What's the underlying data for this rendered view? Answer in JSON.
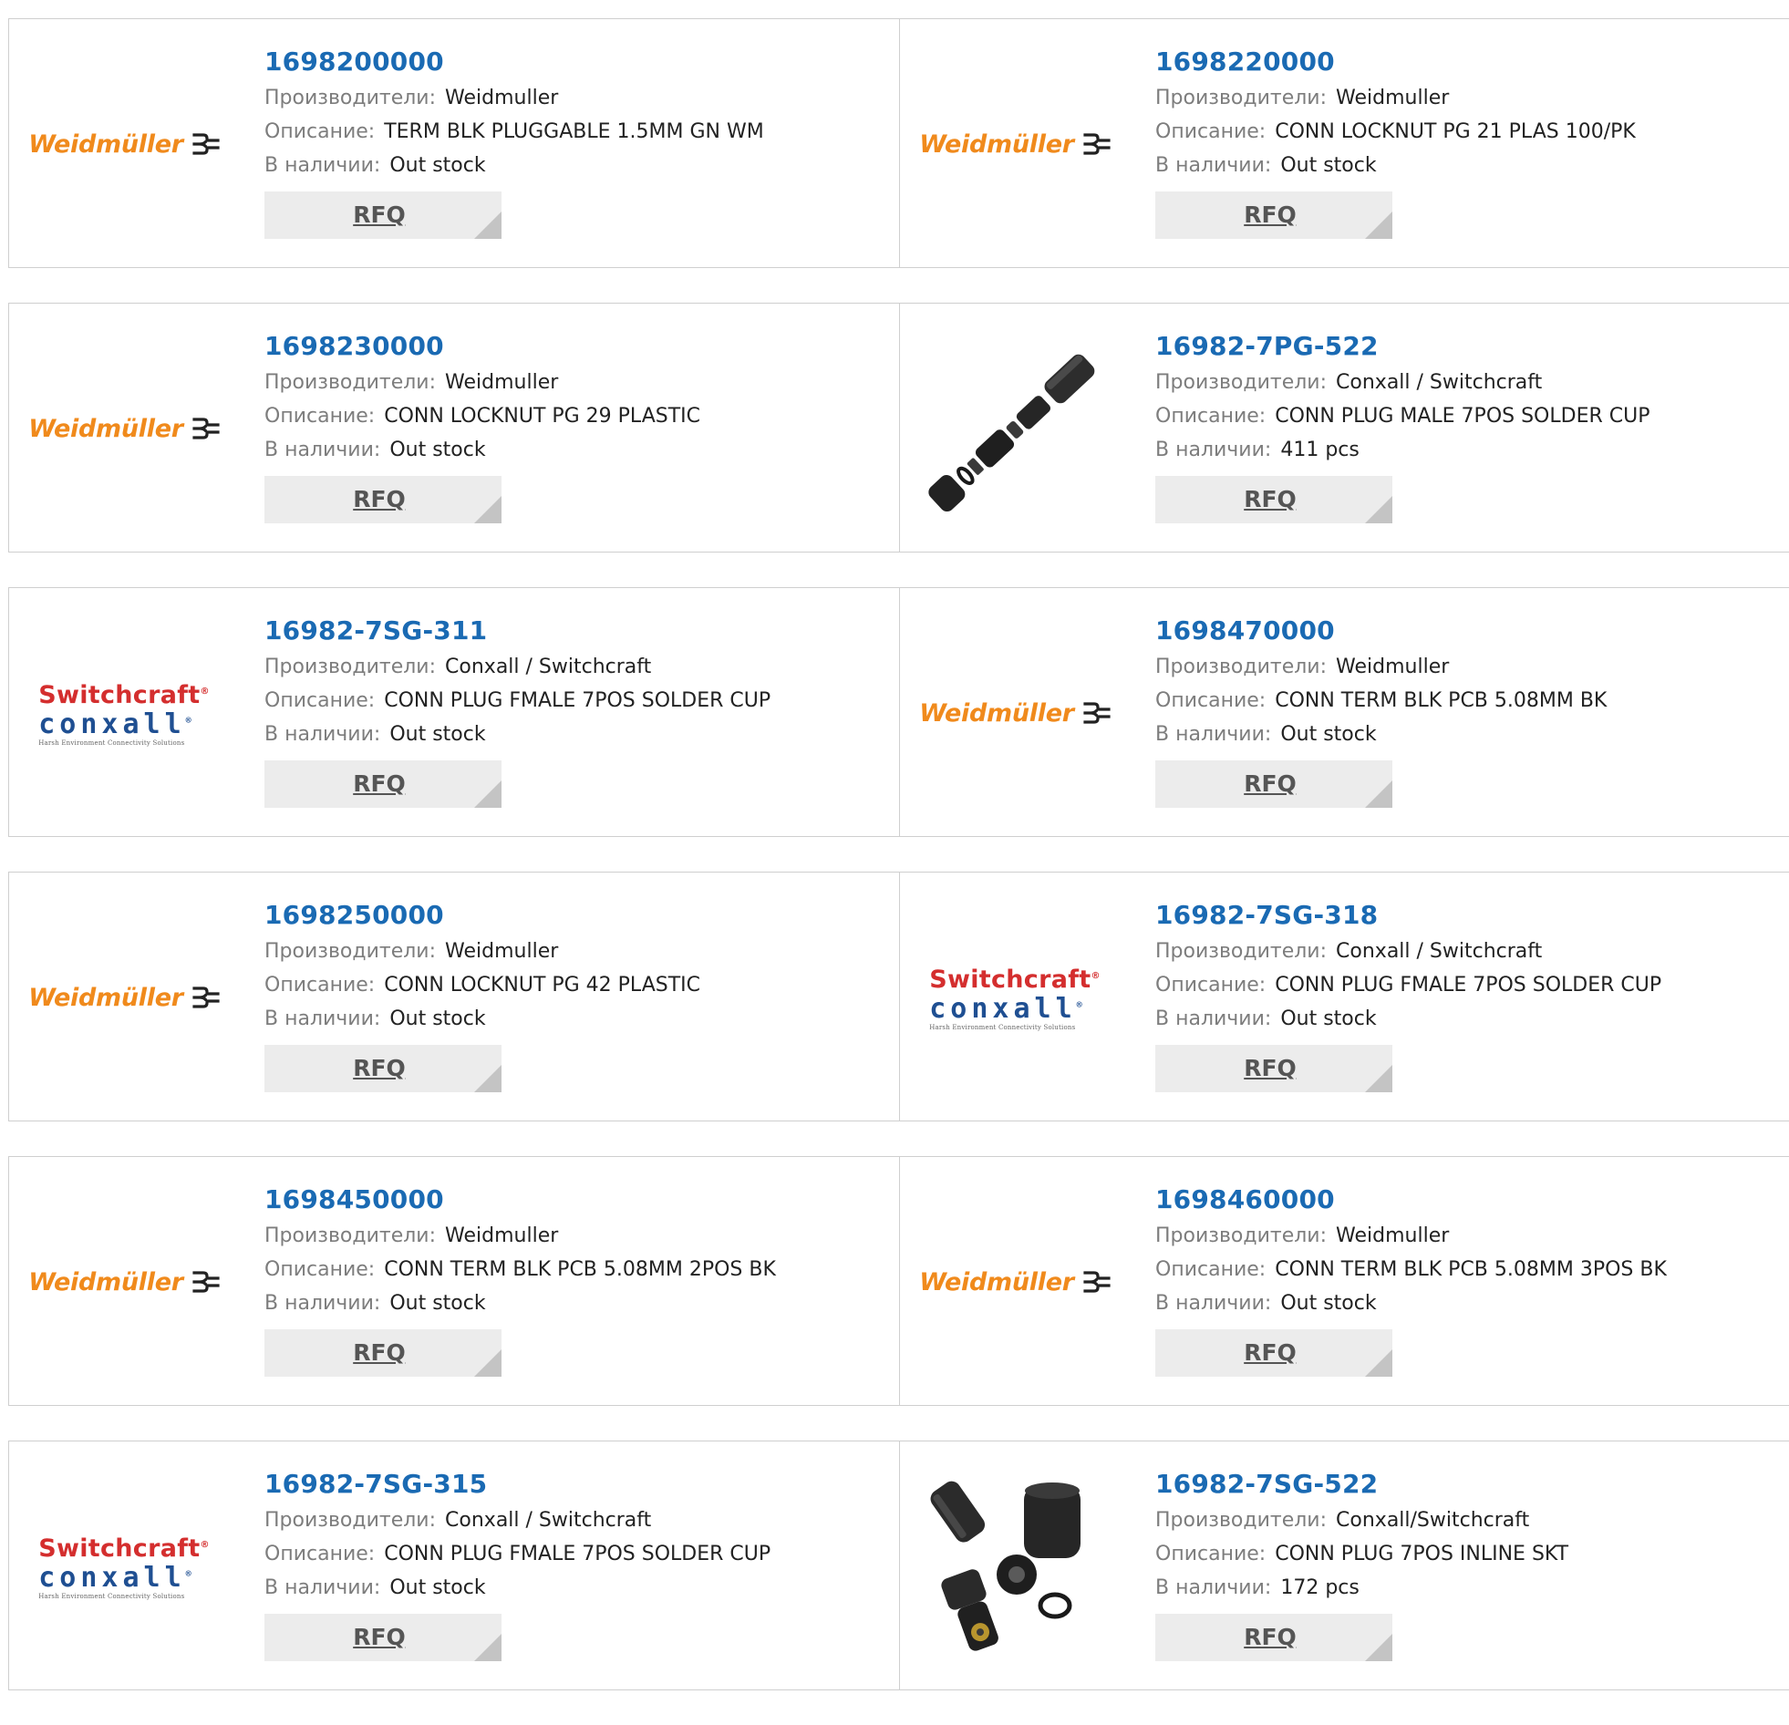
{
  "labels": {
    "manufacturer": "Производители:",
    "description": "Описание:",
    "stock": "В наличии:",
    "rfq": "RFQ"
  },
  "logo_text": {
    "weidmuller": "Weidmüller",
    "switchcraft": "Switchcraft",
    "conxall": "conxall",
    "conxall_tagline": "Harsh Environment Connectivity Solutions"
  },
  "colors": {
    "part_number": "#1a6ab3",
    "label": "#7d7d7d",
    "value": "#222222",
    "rfq_bg": "#ececec",
    "border": "#cfcfcf",
    "weidmuller_orange": "#f08a1c",
    "switchcraft_red": "#d42e2e",
    "conxall_blue": "#1f4f92"
  },
  "products": [
    {
      "part_number": "1698200000",
      "manufacturer": "Weidmuller",
      "description": "TERM BLK PLUGGABLE 1.5MM GN WM",
      "stock": "Out stock",
      "image": "weidmuller-logo"
    },
    {
      "part_number": "1698220000",
      "manufacturer": "Weidmuller",
      "description": "CONN LOCKNUT PG 21 PLAS 100/PK",
      "stock": "Out stock",
      "image": "weidmuller-logo"
    },
    {
      "part_number": "1698230000",
      "manufacturer": "Weidmuller",
      "description": "CONN LOCKNUT PG 29 PLASTIC",
      "stock": "Out stock",
      "image": "weidmuller-logo"
    },
    {
      "part_number": "16982-7PG-522",
      "manufacturer": "Conxall / Switchcraft",
      "description": "CONN PLUG MALE 7POS SOLDER CUP",
      "stock": "411 pcs",
      "image": "connector-exploded-photo"
    },
    {
      "part_number": "16982-7SG-311",
      "manufacturer": "Conxall / Switchcraft",
      "description": "CONN PLUG FMALE 7POS SOLDER CUP",
      "stock": "Out stock",
      "image": "switchcraft-conxall-logo"
    },
    {
      "part_number": "1698470000",
      "manufacturer": "Weidmuller",
      "description": "CONN TERM BLK PCB 5.08MM BK",
      "stock": "Out stock",
      "image": "weidmuller-logo"
    },
    {
      "part_number": "1698250000",
      "manufacturer": "Weidmuller",
      "description": "CONN LOCKNUT PG 42 PLASTIC",
      "stock": "Out stock",
      "image": "weidmuller-logo"
    },
    {
      "part_number": "16982-7SG-318",
      "manufacturer": "Conxall / Switchcraft",
      "description": "CONN PLUG FMALE 7POS SOLDER CUP",
      "stock": "Out stock",
      "image": "switchcraft-conxall-logo"
    },
    {
      "part_number": "1698450000",
      "manufacturer": "Weidmuller",
      "description": "CONN TERM BLK PCB 5.08MM 2POS BK",
      "stock": "Out stock",
      "image": "weidmuller-logo"
    },
    {
      "part_number": "1698460000",
      "manufacturer": "Weidmuller",
      "description": "CONN TERM BLK PCB 5.08MM 3POS BK",
      "stock": "Out stock",
      "image": "weidmuller-logo"
    },
    {
      "part_number": "16982-7SG-315",
      "manufacturer": "Conxall / Switchcraft",
      "description": "CONN PLUG FMALE 7POS SOLDER CUP",
      "stock": "Out stock",
      "image": "switchcraft-conxall-logo"
    },
    {
      "part_number": "16982-7SG-522",
      "manufacturer": "Conxall/Switchcraft",
      "description": "CONN PLUG 7POS INLINE SKT",
      "stock": "172 pcs",
      "image": "connector-parts-photo"
    }
  ]
}
